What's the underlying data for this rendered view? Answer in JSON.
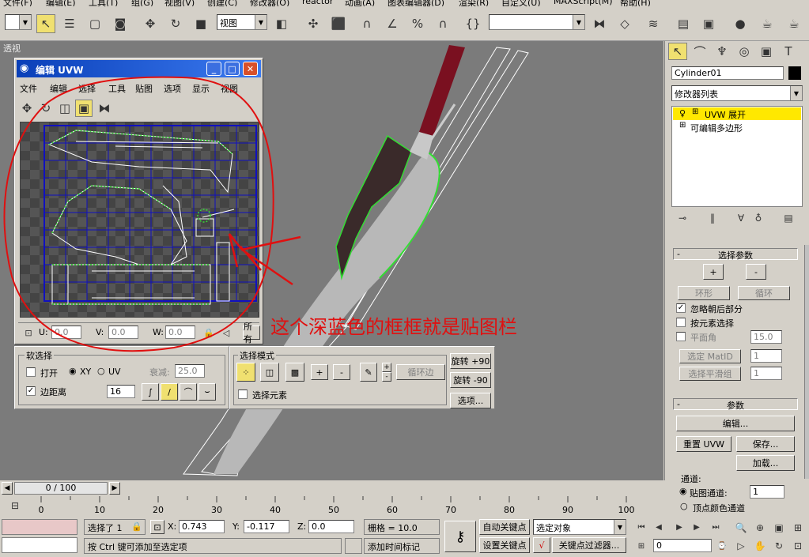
{
  "menubar": [
    "文件(F)",
    "编辑(E)",
    "工具(T)",
    "组(G)",
    "视图(V)",
    "创建(C)",
    "修改器(O)",
    "reactor",
    "动画(A)",
    "图表编辑器(D)",
    "渲染(R)",
    "自定义(U)",
    "MAXScript(M)",
    "帮助(H)"
  ],
  "toolbar": {
    "view_combo": "视图",
    "named_sel": ""
  },
  "viewport": {
    "label": "透视"
  },
  "uvw_editor": {
    "title": "编辑 UVW",
    "menu": [
      "文件",
      "编辑",
      "选择",
      "工具",
      "贴图",
      "选项",
      "显示",
      "视图"
    ],
    "u_label": "U:",
    "u_value": "0.0",
    "v_label": "V:",
    "v_value": "0.0",
    "w_label": "W:",
    "w_value": "0.0",
    "all_ids": "所有"
  },
  "soft_select": {
    "title": "软选择",
    "open_label": "打开",
    "xy_label": "XY",
    "uv_label": "UV",
    "falloff_label": "衰减:",
    "falloff_value": "25.0",
    "edge_distance_label": "边距离",
    "edge_distance_value": "16"
  },
  "selection_modes": {
    "title": "选择模式",
    "loop_label": "循环边",
    "select_element_label": "选择元素",
    "rotate_p90": "旋转 +90",
    "rotate_m90": "旋转 -90",
    "options": "选项..."
  },
  "annotation": "这个深蓝色的框框就是贴图栏",
  "command_panel": {
    "object_name": "Cylinder01",
    "modifier_list": "修改器列表",
    "stack": [
      "UVW 展开",
      "可编辑多边形"
    ],
    "select_params": {
      "title": "选择参数",
      "plus": "+",
      "minus": "-",
      "ring": "环形",
      "loop": "循环",
      "ignore_backfacing": "忽略朝后部分",
      "by_element": "按元素选择",
      "planar_angle": "平面角",
      "planar_value": "15.0",
      "select_matid": "选定 MatID",
      "matid_value": "1",
      "select_smooth": "选择平滑组",
      "smooth_value": "1"
    },
    "params": {
      "title": "参数",
      "edit": "编辑...",
      "reset_uvw": "重置 UVW",
      "save": "保存...",
      "load": "加载...",
      "channel_label": "通道:",
      "map_channel": "贴图通道:",
      "map_channel_value": "1",
      "vertex_color": "顶点颜色通道"
    }
  },
  "timeline": {
    "frame_display": "0 / 100",
    "ticks": [
      "0",
      "10",
      "20",
      "30",
      "40",
      "50",
      "60",
      "70",
      "80",
      "90",
      "100"
    ]
  },
  "status": {
    "selected": "选择了 1",
    "x_label": "X:",
    "x_value": "0.743",
    "y_label": "Y:",
    "y_value": "-0.117",
    "z_label": "Z:",
    "z_value": "0.0",
    "grid": "栅格 = 10.0",
    "hint": "按 Ctrl 键可添加至选定项",
    "add_time_tag": "添加时间标记",
    "auto_key": "自动关键点",
    "set_key": "设置关键点",
    "selected_obj": "选定对象",
    "key_filters": "关键点过滤器...",
    "frame_value": "0"
  },
  "colors": {
    "accent": "#0a3fb8",
    "uv_wire": "#33dd33",
    "grid_blue": "#1010c0",
    "annotation": "#e01010",
    "stack_highlight": "#ffe800"
  }
}
